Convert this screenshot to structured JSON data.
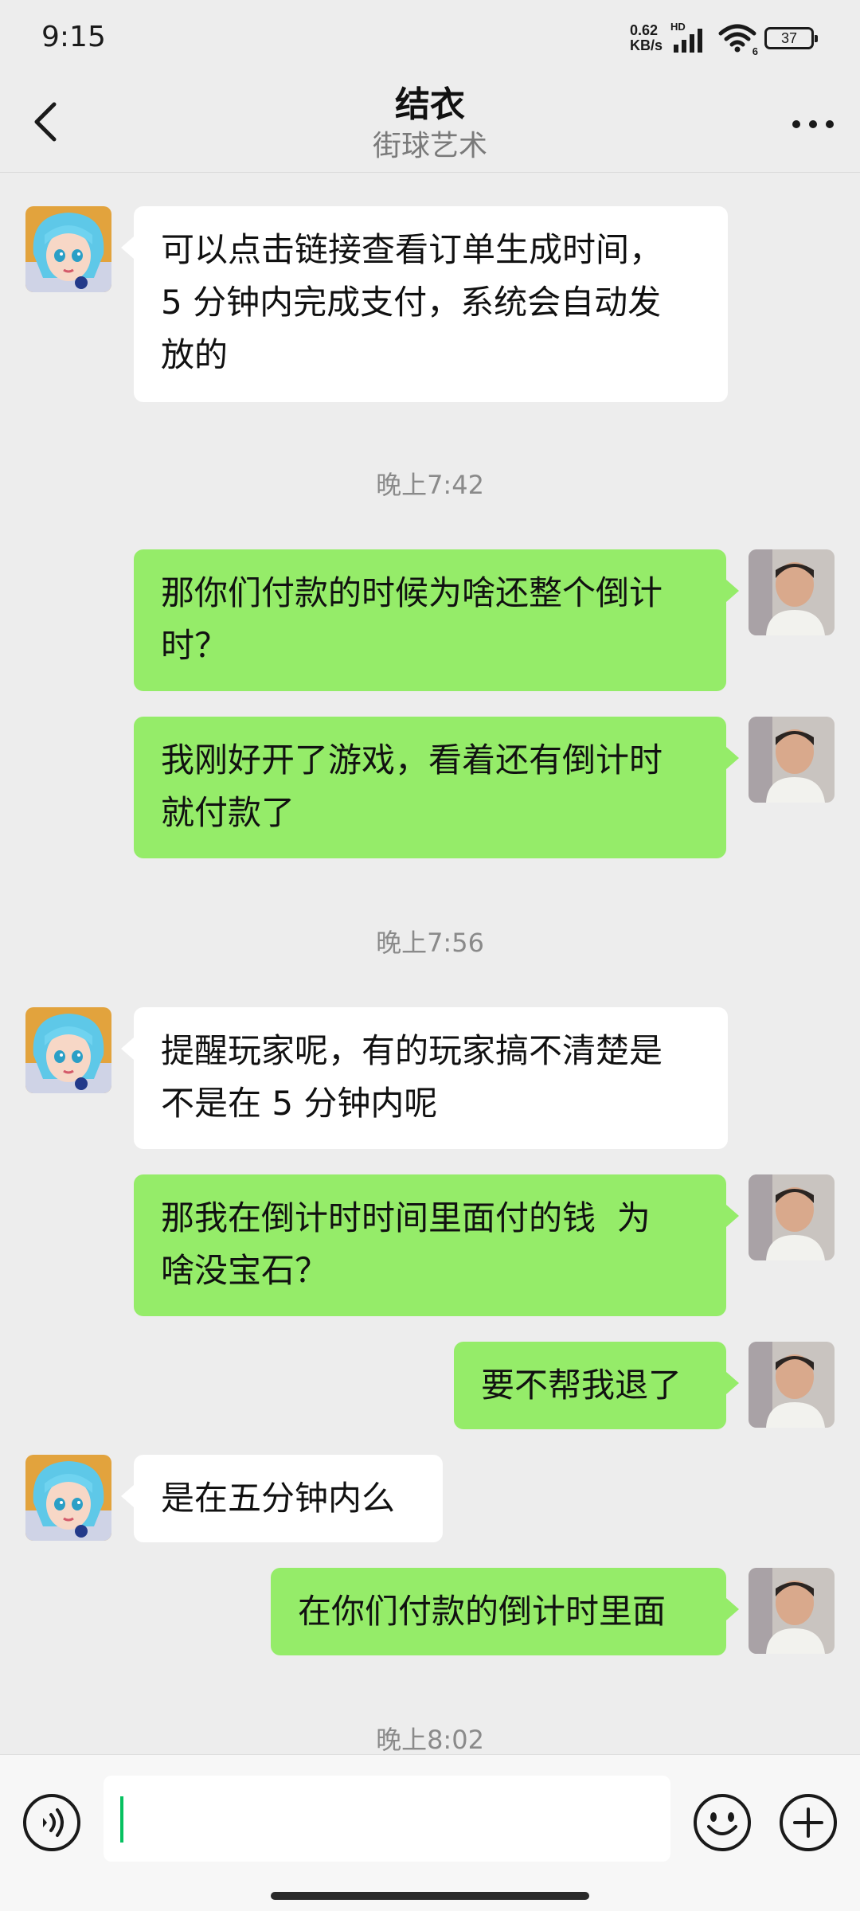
{
  "status_bar": {
    "time": "9:15",
    "net_speed_value": "0.62",
    "net_speed_unit": "KB/s",
    "hd_label": "HD",
    "wifi_label": "6",
    "battery_level": "37"
  },
  "header": {
    "title": "结衣",
    "subtitle": "街球艺术"
  },
  "messages": [
    {
      "text": "可以点击链接查看订单生成时间，\n5 分钟内完成支付，系统会自动发\n放的"
    },
    {
      "text": "晚上7:42"
    },
    {
      "text": "那你们付款的时候为啥还整个倒计\n时？"
    },
    {
      "text": "我刚好开了游戏，看着还有倒计时\n就付款了"
    },
    {
      "text": "晚上7:56"
    },
    {
      "text": "提醒玩家呢，有的玩家搞不清楚是\n不是在 5 分钟内呢"
    },
    {
      "text": "那我在倒计时时间里面付的钱  为\n啥没宝石？"
    },
    {
      "text": "要不帮我退了"
    },
    {
      "text": "是在五分钟内么"
    },
    {
      "text": "在你们付款的倒计时里面"
    },
    {
      "text": "晚上8:02"
    }
  ],
  "input_bar": {
    "value": ""
  },
  "colors": {
    "sent_bubble": "#95ec69",
    "received_bubble": "#ffffff",
    "background": "#ededed",
    "caret": "#07c160"
  }
}
